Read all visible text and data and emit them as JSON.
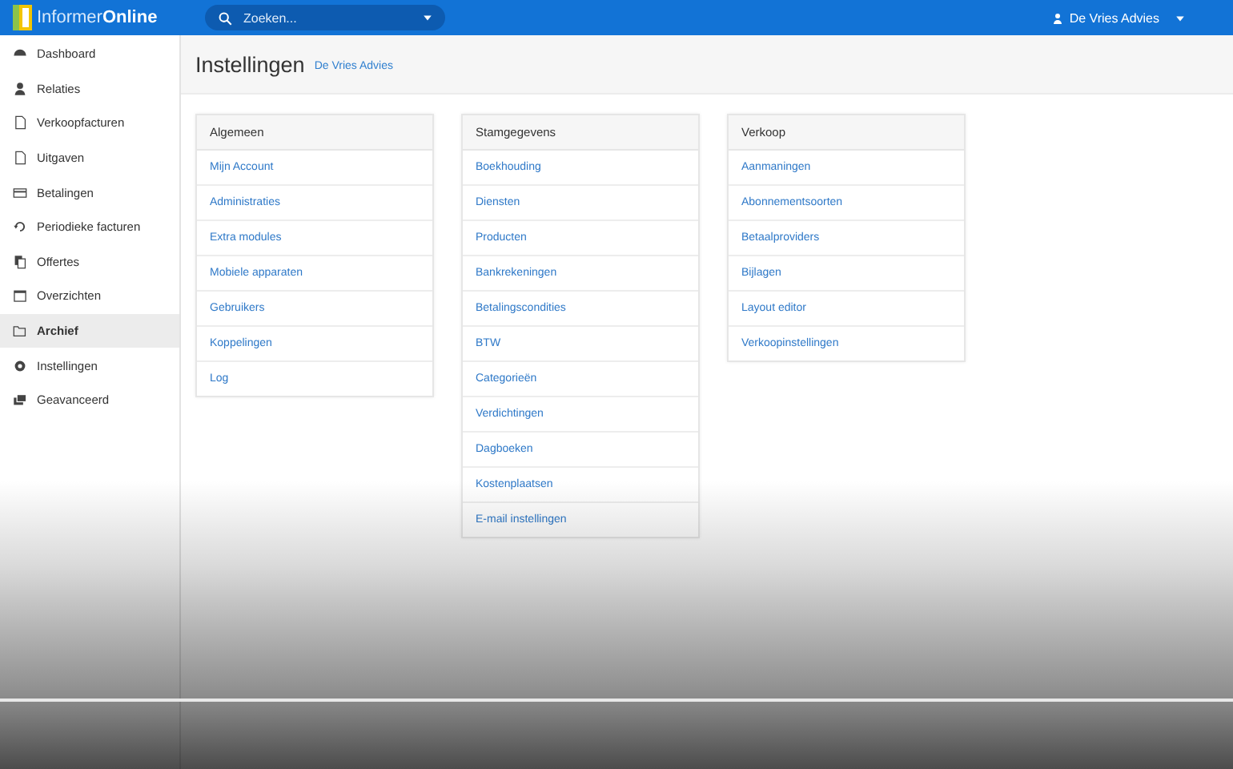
{
  "topbar": {
    "logo_light": "Informer",
    "logo_bold": "Online",
    "search": {
      "placeholder": "Zoeken..."
    },
    "user": "De Vries Advies"
  },
  "sidebar": {
    "items": [
      {
        "label": "Dashboard",
        "selected": false
      },
      {
        "label": "Relaties",
        "selected": false
      },
      {
        "label": "Verkoopfacturen",
        "selected": false
      },
      {
        "label": "Uitgaven",
        "selected": false
      },
      {
        "label": "Betalingen",
        "selected": false
      },
      {
        "label": "Periodieke facturen",
        "selected": false
      },
      {
        "label": "Offertes",
        "selected": false
      },
      {
        "label": "Overzichten",
        "selected": false
      },
      {
        "label": "Archief",
        "selected": true
      },
      {
        "label": "Instellingen",
        "selected": false
      },
      {
        "label": "Geavanceerd",
        "selected": false
      }
    ]
  },
  "page": {
    "title": "Instellingen",
    "subtitle": "De Vries Advies"
  },
  "panels": [
    {
      "title": "Algemeen",
      "items": [
        "Mijn Account",
        "Administraties",
        "Extra modules",
        "Mobiele apparaten",
        "Gebruikers",
        "Koppelingen",
        "Log"
      ]
    },
    {
      "title": "Stamgegevens",
      "items": [
        "Boekhouding",
        "Diensten",
        "Producten",
        "Bankrekeningen",
        "Betalingscondities",
        "BTW",
        "Categorieën",
        "Verdichtingen",
        "Dagboeken",
        "Kostenplaatsen",
        "E-mail instellingen"
      ]
    },
    {
      "title": "Verkoop",
      "items": [
        "Aanmaningen",
        "Abonnementsoorten",
        "Betaalproviders",
        "Bijlagen",
        "Layout editor",
        "Verkoopinstellingen"
      ]
    }
  ]
}
